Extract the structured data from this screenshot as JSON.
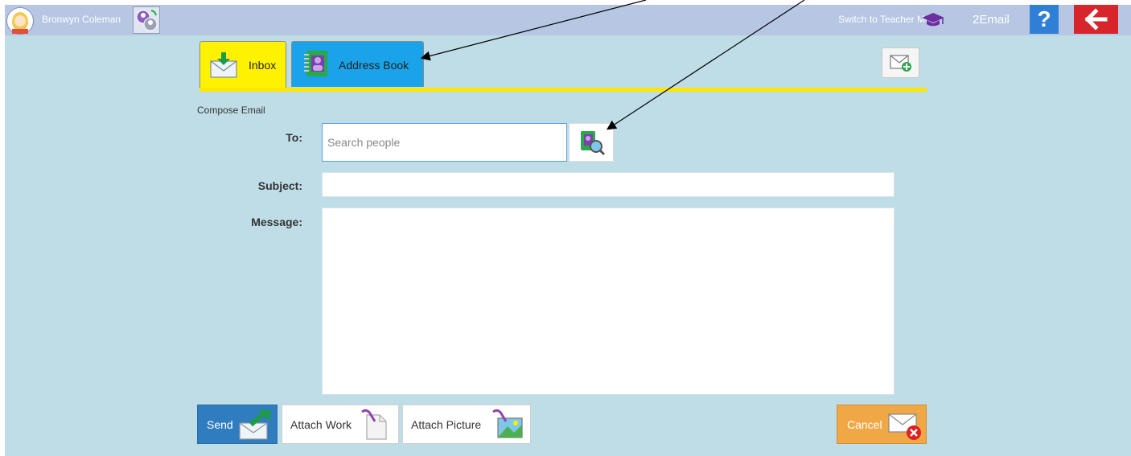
{
  "topbar": {
    "user_name": "Bronwyn Coleman",
    "switch_mode_label": "Switch to Teacher Mode",
    "app_name": "2Email",
    "help_label": "?"
  },
  "tabs": [
    {
      "label": "Inbox",
      "icon": "inbox-download-icon",
      "active": true
    },
    {
      "label": "Address Book",
      "icon": "address-book-icon",
      "active": false
    }
  ],
  "compose": {
    "title": "Compose Email",
    "to_label": "To:",
    "to_placeholder": "Search people",
    "subject_label": "Subject:",
    "message_label": "Message:"
  },
  "buttons": {
    "send": "Send",
    "attach_work": "Attach Work",
    "attach_picture": "Attach Picture",
    "cancel": "Cancel"
  },
  "colors": {
    "topbar": "#b6c6e3",
    "background": "#bfdde6",
    "inbox_tab": "#fff200",
    "address_tab": "#1aa3e8",
    "send_button": "#2f7dbf",
    "cancel_button": "#f0a847",
    "help_button": "#2f7fd6",
    "back_button": "#d7252c"
  }
}
